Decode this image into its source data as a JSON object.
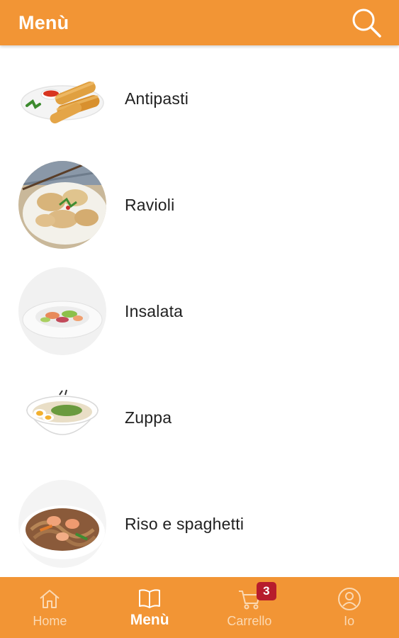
{
  "app_bar": {
    "title": "Menù",
    "search_icon": "search-icon"
  },
  "categories": [
    {
      "label": "Antipasti",
      "image": "spring-rolls-plate"
    },
    {
      "label": "Ravioli",
      "image": "dumplings-plate"
    },
    {
      "label": "Insalata",
      "image": "salad-plate"
    },
    {
      "label": "Zuppa",
      "image": "ramen-soup-bowl"
    },
    {
      "label": "Riso e spaghetti",
      "image": "stir-fried-noodles"
    }
  ],
  "bottom_nav": {
    "items": [
      {
        "label": "Home",
        "icon": "home-icon",
        "active": false
      },
      {
        "label": "Menù",
        "icon": "book-icon",
        "active": true
      },
      {
        "label": "Carrello",
        "icon": "cart-icon",
        "active": false,
        "badge": "3"
      },
      {
        "label": "Io",
        "icon": "user-icon",
        "active": false
      }
    ]
  },
  "colors": {
    "primary": "#F29535",
    "badge": "#B71C2C",
    "inactive_nav": "#FBD9B3",
    "text": "#212121"
  }
}
